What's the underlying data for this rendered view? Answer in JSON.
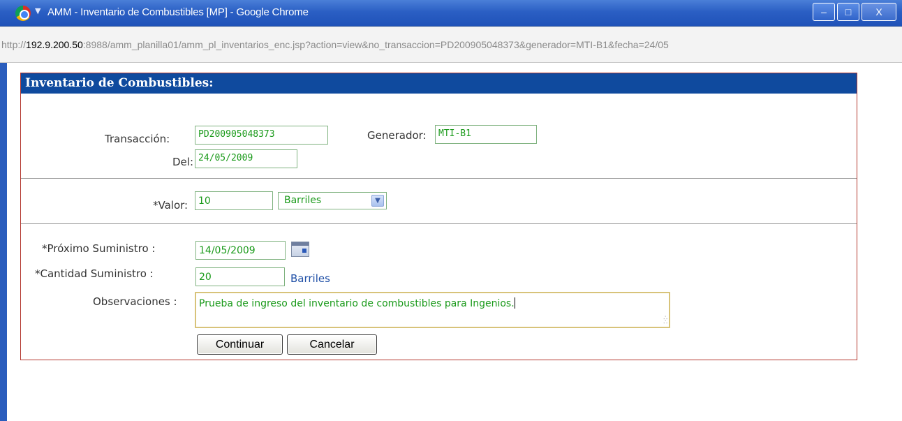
{
  "window": {
    "title": "AMM - Inventario de Combustibles [MP] - Google Chrome",
    "minimize_glyph": "–",
    "maximize_glyph": "□",
    "close_glyph": "X"
  },
  "address": {
    "scheme": "http://",
    "host": "192.9.200.50",
    "rest": ":8988/amm_planilla01/amm_pl_inventarios_enc.jsp?action=view&no_transaccion=PD200905048373&generador=MTI-B1&fecha=24/05"
  },
  "form": {
    "header": "Inventario de Combustibles:",
    "transaccion_label": "Transacción:",
    "transaccion_value": "PD200905048373",
    "generador_label": "Generador:",
    "generador_value": "MTI-B1",
    "del_label": "Del:",
    "del_value": "24/05/2009",
    "valor_label": "*Valor:",
    "valor_value": "10",
    "valor_unit_selected": "Barriles",
    "proximo_label": "*Próximo Suministro :",
    "proximo_value": "14/05/2009",
    "cantidad_label": "*Cantidad Suministro :",
    "cantidad_value": "20",
    "cantidad_unit": "Barriles",
    "observaciones_label": "Observaciones :",
    "observaciones_value": "Prueba de ingreso del inventario de combustibles para Ingenios.",
    "continuar_label": "Continuar",
    "cancelar_label": "Cancelar"
  },
  "colors": {
    "header_bg": "#0f4a9e",
    "panel_border": "#b3362d",
    "field_text": "#1a9a1a",
    "unit_text": "#1f4fa6"
  }
}
